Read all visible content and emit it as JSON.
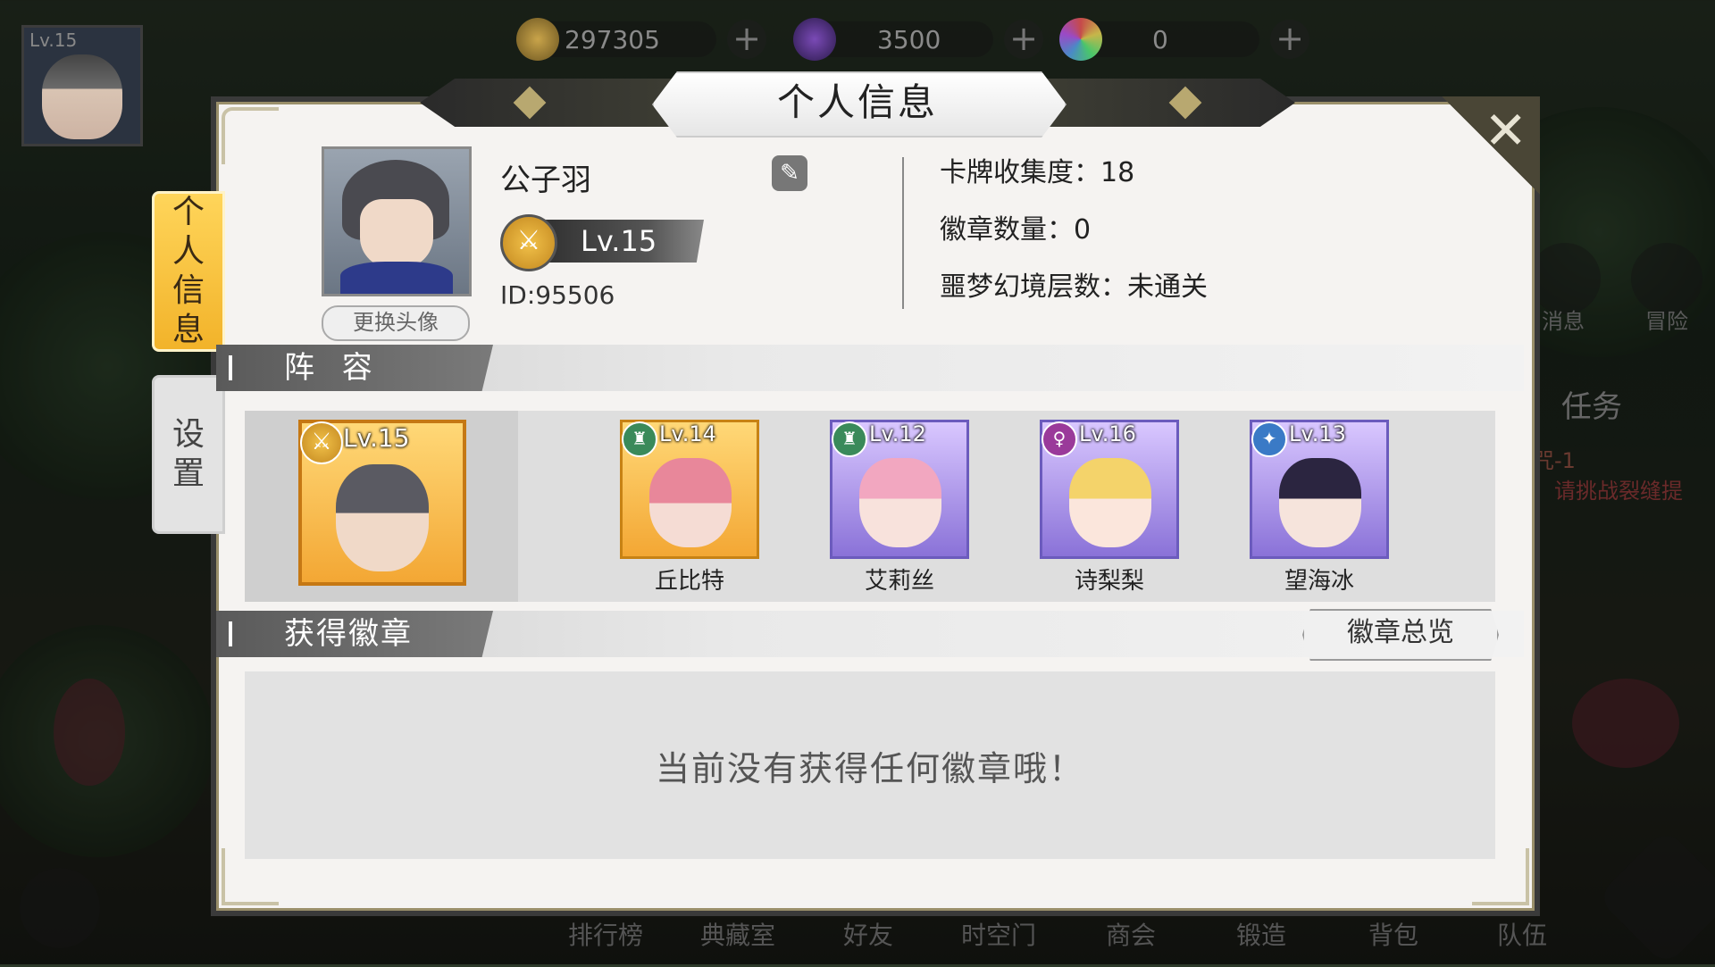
{
  "resources": [
    {
      "icon": "gold-coin-icon",
      "value": "297305",
      "color": "#b8962e"
    },
    {
      "icon": "purple-gem-icon",
      "value": "3500",
      "color": "#6a3fa6"
    },
    {
      "icon": "rainbow-orb-icon",
      "value": "0",
      "color": "#4a9ab8"
    }
  ],
  "resource_plus": "+",
  "mini_player": {
    "level": "Lv.15"
  },
  "side_menu": {
    "messages": "消息",
    "adventure": "冒险",
    "tasks": "任务",
    "task_hint_a": "咒-1",
    "task_hint_b": "请挑战裂缝提"
  },
  "bottom_nav": [
    "排行榜",
    "典藏室",
    "好友",
    "时空门",
    "商会",
    "锻造",
    "背包",
    "队伍"
  ],
  "dialog": {
    "title": "个人信息",
    "close": "✕",
    "tabs": [
      {
        "label": "个人信息",
        "active": true
      },
      {
        "label": "设置",
        "active": false
      }
    ],
    "profile": {
      "name": "公子羽",
      "edit_icon": "✎",
      "level": "Lv.15",
      "level_emblem": "⚔",
      "id": "ID:95506",
      "change_avatar": "更换头像"
    },
    "stats": [
      "卡牌收集度：18",
      "徽章数量：0",
      "噩梦幻境层数：未通关"
    ],
    "team_section": "阵 容",
    "team": [
      {
        "name": "",
        "level": "Lv.15",
        "emblem": "⚔",
        "frame": "gold",
        "face": "#5a5a62"
      },
      {
        "name": "丘比特",
        "level": "Lv.14",
        "emblem": "♜",
        "frame": "gold",
        "face": "#e8879a"
      },
      {
        "name": "艾莉丝",
        "level": "Lv.12",
        "emblem": "♜",
        "frame": "purple",
        "face": "#f2a7c0"
      },
      {
        "name": "诗梨梨",
        "level": "Lv.16",
        "emblem": "♀",
        "frame": "purple",
        "face": "#f4d36a"
      },
      {
        "name": "望海冰",
        "level": "Lv.13",
        "emblem": "✦",
        "frame": "purple",
        "face": "#2b2540"
      }
    ],
    "badge_section": "获得徽章",
    "badge_overview": "徽章总览",
    "badge_empty": "当前没有获得任何徽章哦！"
  }
}
